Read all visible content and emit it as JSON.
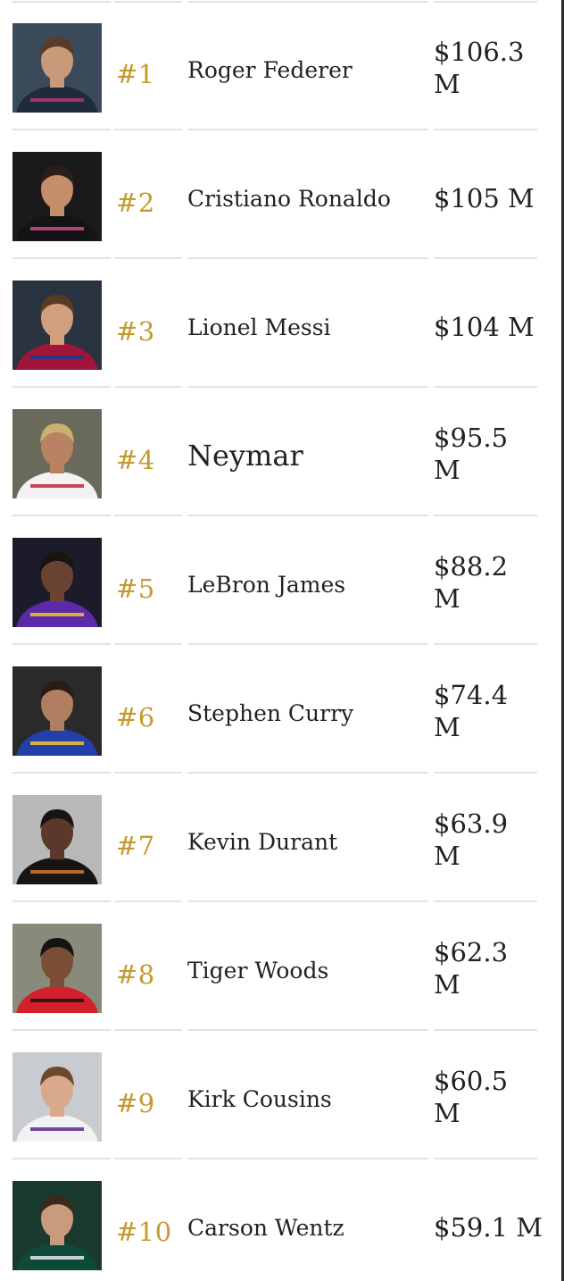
{
  "athletes": [
    {
      "rank": "#1",
      "name": "Roger Federer",
      "earnings": "$106.3 M",
      "photo_icon": "athlete-photo-icon",
      "colors": {
        "bg": "#3b4a5a",
        "skin": "#c99a7a",
        "hair": "#5a3b2a",
        "shirt": "#1e2b3a",
        "accent": "#c0306a"
      }
    },
    {
      "rank": "#2",
      "name": "Cristiano Ronaldo",
      "earnings": "$105 M",
      "photo_icon": "athlete-photo-icon",
      "colors": {
        "bg": "#1a1a1a",
        "skin": "#c48e6a",
        "hair": "#2b1f18",
        "shirt": "#141414",
        "accent": "#d04a8a"
      }
    },
    {
      "rank": "#3",
      "name": "Lionel Messi",
      "earnings": "$104 M",
      "photo_icon": "athlete-photo-icon",
      "colors": {
        "bg": "#2a3340",
        "skin": "#d0a07e",
        "hair": "#5b3a24",
        "shirt": "#a3143a",
        "accent": "#1d3a8a"
      }
    },
    {
      "rank": "#4",
      "name": "Neymar",
      "earnings": "$95.5 M",
      "photo_icon": "athlete-photo-icon",
      "colors": {
        "bg": "#6a6a5a",
        "skin": "#b98262",
        "hair": "#c9b070",
        "shirt": "#f2f2f2",
        "accent": "#c0243a"
      }
    },
    {
      "rank": "#5",
      "name": "LeBron James",
      "earnings": "$88.2 M",
      "photo_icon": "athlete-photo-icon",
      "colors": {
        "bg": "#1b1b2a",
        "skin": "#6a4332",
        "hair": "#1a1410",
        "shirt": "#5a2aa8",
        "accent": "#f2c230"
      }
    },
    {
      "rank": "#6",
      "name": "Stephen Curry",
      "earnings": "$74.4 M",
      "photo_icon": "athlete-photo-icon",
      "colors": {
        "bg": "#2a2a2a",
        "skin": "#b07e60",
        "hair": "#2a1c14",
        "shirt": "#2340a8",
        "accent": "#f2c230"
      }
    },
    {
      "rank": "#7",
      "name": "Kevin Durant",
      "earnings": "$63.9 M",
      "photo_icon": "athlete-photo-icon",
      "colors": {
        "bg": "#b8b8b8",
        "skin": "#5a382a",
        "hair": "#1a1410",
        "shirt": "#151515",
        "accent": "#d8742a"
      }
    },
    {
      "rank": "#8",
      "name": "Tiger Woods",
      "earnings": "$62.3 M",
      "photo_icon": "athlete-photo-icon",
      "colors": {
        "bg": "#8a8a7a",
        "skin": "#7a4e36",
        "hair": "#141414",
        "shirt": "#d4202a",
        "accent": "#141414"
      }
    },
    {
      "rank": "#9",
      "name": "Kirk Cousins",
      "earnings": "$60.5 M",
      "photo_icon": "athlete-photo-icon",
      "colors": {
        "bg": "#c8ccd0",
        "skin": "#d8a98a",
        "hair": "#6a4a2a",
        "shirt": "#f2f2f2",
        "accent": "#5a2a90"
      }
    },
    {
      "rank": "#10",
      "name": "Carson Wentz",
      "earnings": "$59.1 M",
      "photo_icon": "athlete-photo-icon",
      "colors": {
        "bg": "#1a3a30",
        "skin": "#c89a7e",
        "hair": "#3a2a1a",
        "shirt": "#0d4a3a",
        "accent": "#e8e8e8"
      }
    }
  ],
  "colors": {
    "rank_text": "#c39a2b",
    "body_text": "#222222",
    "divider": "#e3e3e3"
  }
}
